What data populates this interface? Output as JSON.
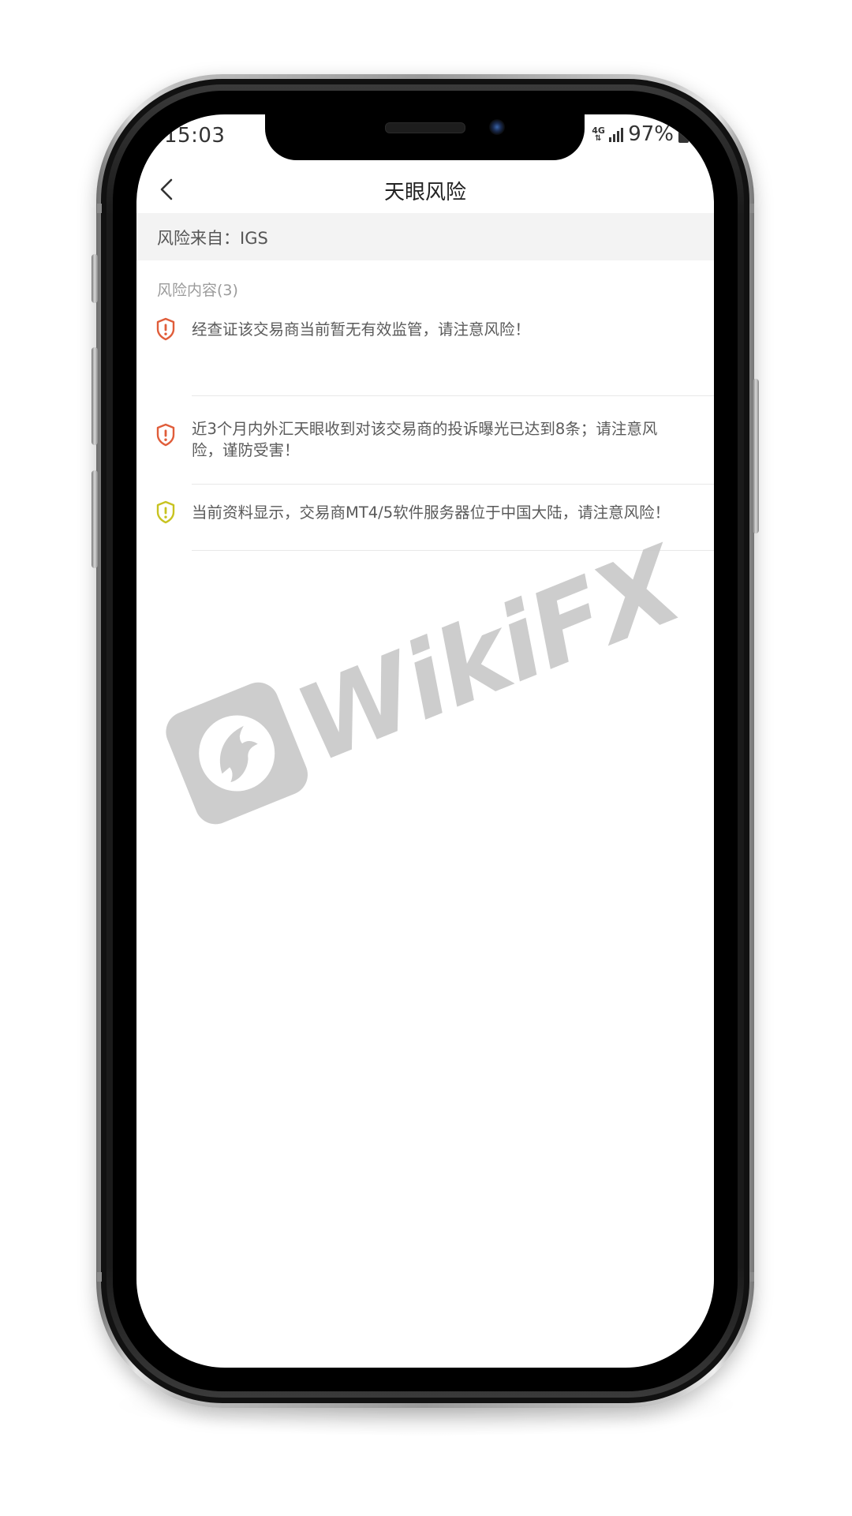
{
  "status_bar": {
    "time": "15:03",
    "network": "4G",
    "battery_percent": "97%"
  },
  "nav": {
    "back_icon": "chevron-left-icon",
    "title": "天眼风险"
  },
  "source": {
    "text": "风险来自：IGS"
  },
  "risk_section": {
    "header": "风险内容(3)",
    "items": [
      {
        "text": "经查证该交易商当前暂无有效监管，请注意风险！",
        "icon": "shield-alert-icon",
        "color": "#e05d3a"
      },
      {
        "text": "近3个月内外汇天眼收到对该交易商的投诉曝光已达到8条；请注意风险，谨防受害！",
        "icon": "shield-alert-icon",
        "color": "#e05d3a"
      },
      {
        "text": "当前资料显示，交易商MT4/5软件服务器位于中国大陆，请注意风险！",
        "icon": "shield-alert-icon",
        "color": "#c8c320"
      }
    ]
  },
  "watermark": {
    "text": "WikiFX",
    "logo_icon": "eagle-logo-icon"
  },
  "colors": {
    "danger": "#e05d3a",
    "warning": "#c8c320",
    "banner_bg": "#f3f3f3",
    "text": "#5a5a5a",
    "muted": "#9b9b9b"
  }
}
